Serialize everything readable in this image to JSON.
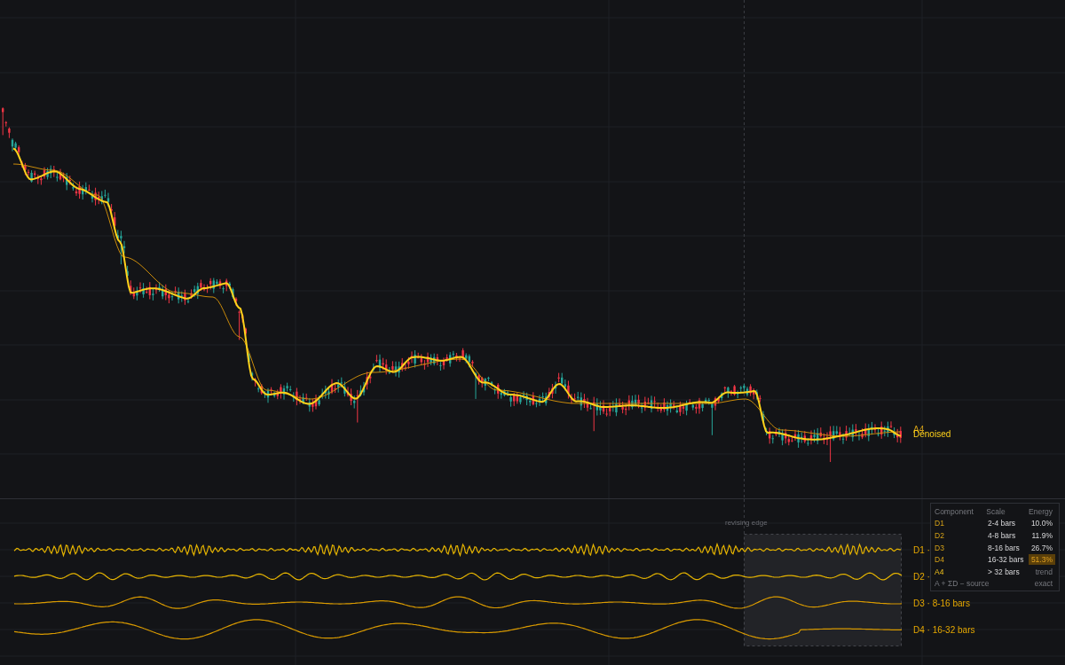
{
  "main_chart": {
    "labels": [
      {
        "text": "A4",
        "kind": "trend"
      },
      {
        "text": "Denoised",
        "kind": "denoised"
      }
    ]
  },
  "detail_panel": {
    "edge_label": "revising edge",
    "components": [
      {
        "label": "D1 ·"
      },
      {
        "label": "D2 ·"
      },
      {
        "label": "D3 · 8-16 bars"
      },
      {
        "label": "D4 · 16-32 bars"
      }
    ]
  },
  "energy_table": {
    "columns": [
      "Component",
      "Scale",
      "Energy"
    ],
    "rows": [
      {
        "component": "D1",
        "scale": "2-4 bars",
        "energy": "10.0%",
        "kind": "detail",
        "selected": false
      },
      {
        "component": "D2",
        "scale": "4-8 bars",
        "energy": "11.9%",
        "kind": "detail",
        "selected": false
      },
      {
        "component": "D3",
        "scale": "8-16 bars",
        "energy": "26.7%",
        "kind": "detail",
        "selected": false
      },
      {
        "component": "D4",
        "scale": "16-32 bars",
        "energy": "51.3%",
        "kind": "detail",
        "selected": true
      },
      {
        "component": "A4",
        "scale": "> 32 bars",
        "energy": "trend",
        "kind": "approx",
        "selected": false
      }
    ],
    "footer": {
      "formula": "A + ΣD − source",
      "result": "exact"
    }
  }
}
